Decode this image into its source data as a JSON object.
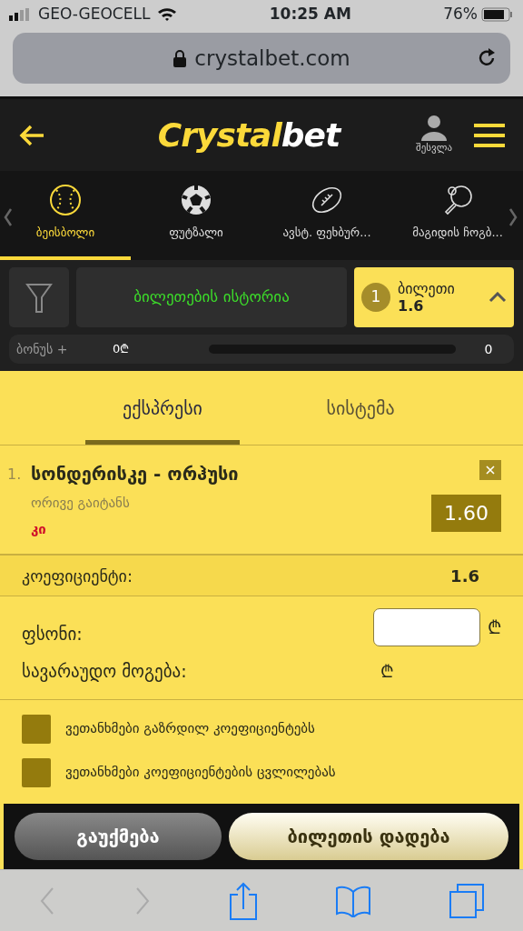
{
  "status_bar": {
    "carrier": "GEO-GEOCELL",
    "time": "10:25 AM",
    "battery": "76%"
  },
  "address_bar": {
    "url": "crystalbet.com"
  },
  "header": {
    "logo": [
      "Crystal",
      "bet"
    ],
    "login": "შესვლა"
  },
  "sports": [
    {
      "kind": "baseball",
      "label": "ბეისბოლი",
      "selected": true
    },
    {
      "kind": "soccer",
      "label": "ფუტზალი",
      "selected": false
    },
    {
      "kind": "football",
      "label": "ავსტ. ფეხბურ...",
      "selected": false
    },
    {
      "kind": "pingpong",
      "label": "მაგიდის ჩოგბ...",
      "selected": false
    }
  ],
  "history_button": "ბილეთების ისტორია",
  "ticket": {
    "count": "1",
    "label": "ბილეთი",
    "odds": "1.6"
  },
  "bonus": {
    "label": "ბონუს +",
    "amount": "0₾",
    "level": 0,
    "reading": "0"
  },
  "bet_tabs": [
    {
      "label": "ექსპრესი",
      "selected": true
    },
    {
      "label": "სისტემა",
      "selected": false
    }
  ],
  "selection": {
    "number": "1.",
    "match": "სონდერისკე - ორჰუსი",
    "market": "ორივე გაიტანს",
    "outcome": "კი",
    "odds": "1.60"
  },
  "coefficient": {
    "label": "კოეფიციენტი:",
    "value": "1.6"
  },
  "stake": {
    "label": "ფსონი:",
    "currency": "₾"
  },
  "potential_win": {
    "label": "სავარაუდო მოგება:",
    "currency": "₾"
  },
  "agreements": [
    {
      "label": "ვეთანხმები გაზრდილ კოეფიციენტებს",
      "checked": false
    },
    {
      "label": "ვეთანხმები კოეფიციენტების ცვლილებას",
      "checked": false
    }
  ],
  "buttons": {
    "cancel": "გაუქმება",
    "place": "ბილეთის დადება"
  }
}
